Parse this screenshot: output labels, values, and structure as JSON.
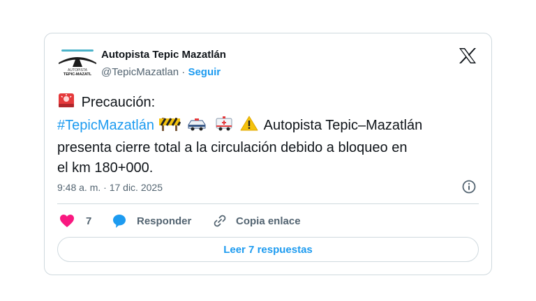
{
  "tweet": {
    "author": {
      "name": "Autopista Tepic Mazatlán",
      "handle": "@TepicMazatlan",
      "separator": "·",
      "follow_label": "Seguir",
      "avatar_logo_text": "AUTOPISTA TEPIC-MAZATLÁN"
    },
    "body": {
      "line1": "Precaución:",
      "hashtag": "#TepicMazatlán",
      "line2_text": "Autopista Tepic–Mazatlán",
      "line3": "presenta cierre total a la circulación debido a bloqueo en",
      "line4": "el km 180+000.",
      "emojis": [
        "siren-emoji",
        "construction-emoji",
        "police-car-emoji",
        "ambulance-emoji",
        "warning-emoji"
      ]
    },
    "timestamp": "9:48 a. m. · 17 dic. 2025",
    "actions": {
      "like_count": "7",
      "reply_label": "Responder",
      "copy_link_label": "Copia enlace"
    },
    "read_replies_label": "Leer 7 respuestas"
  },
  "colors": {
    "accent": "#1d9bf0",
    "heart": "#f91880",
    "secondary_text": "#536471",
    "border": "#cfd9de"
  }
}
